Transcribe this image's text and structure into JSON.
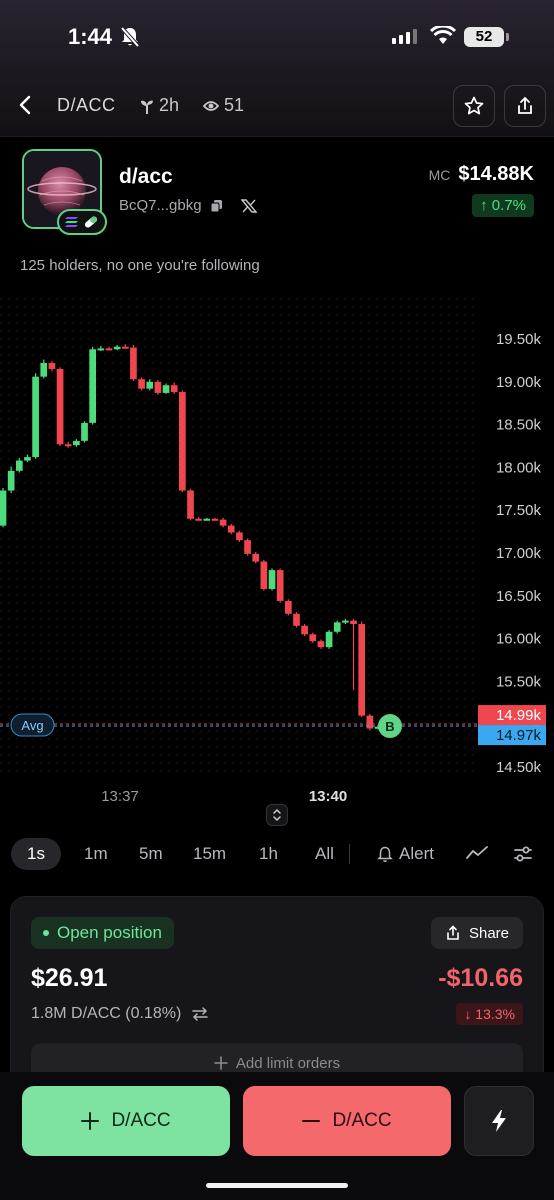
{
  "status_bar": {
    "time": "1:44",
    "battery": "52"
  },
  "nav": {
    "title": "D/ACC",
    "age": "2h",
    "watchers": "51"
  },
  "token": {
    "name": "d/acc",
    "address": "BcQ7...gbkg",
    "mc_label": "MC",
    "market_cap": "$14.88K",
    "mc_change": "↑ 0.7%",
    "holders_text": "125 holders, no one you're following"
  },
  "chart_data": {
    "type": "candlestick",
    "interval": "1s",
    "y_ticks": [
      "19.50k",
      "19.00k",
      "18.50k",
      "18.00k",
      "17.50k",
      "17.00k",
      "16.50k",
      "16.00k",
      "15.50k",
      "15.00k",
      "14.50k"
    ],
    "y_tick_values": [
      19500,
      19000,
      18500,
      18000,
      17500,
      17000,
      16500,
      16000,
      15500,
      15000,
      14500
    ],
    "x_ticks": [
      "13:37",
      "13:40"
    ],
    "avg_label": "Avg",
    "buy_marker": "B",
    "price_label_1": "14.99k",
    "price_label_2": "14.97k",
    "candles": [
      {
        "o": 17320,
        "c": 17730,
        "h": 17760,
        "l": 17300
      },
      {
        "o": 17730,
        "c": 17960,
        "h": 18010,
        "l": 17700
      },
      {
        "o": 17960,
        "c": 18080,
        "h": 18110,
        "l": 17940
      },
      {
        "o": 18080,
        "c": 18120,
        "h": 18150,
        "l": 18060
      },
      {
        "o": 18120,
        "c": 19060,
        "h": 19100,
        "l": 18100
      },
      {
        "o": 19060,
        "c": 19220,
        "h": 19260,
        "l": 19040
      },
      {
        "o": 19220,
        "c": 19150,
        "h": 19240,
        "l": 19120
      },
      {
        "o": 19150,
        "c": 18270,
        "h": 19170,
        "l": 18250
      },
      {
        "o": 18270,
        "c": 18260,
        "h": 18300,
        "l": 18230
      },
      {
        "o": 18260,
        "c": 18310,
        "h": 18330,
        "l": 18240
      },
      {
        "o": 18310,
        "c": 18520,
        "h": 18540,
        "l": 18290
      },
      {
        "o": 18520,
        "c": 19380,
        "h": 19410,
        "l": 18500
      },
      {
        "o": 19380,
        "c": 19390,
        "h": 19420,
        "l": 19360
      },
      {
        "o": 19390,
        "c": 19380,
        "h": 19410,
        "l": 19370
      },
      {
        "o": 19380,
        "c": 19410,
        "h": 19430,
        "l": 19370
      },
      {
        "o": 19410,
        "c": 19400,
        "h": 19440,
        "l": 19390
      },
      {
        "o": 19400,
        "c": 19030,
        "h": 19430,
        "l": 19010
      },
      {
        "o": 19030,
        "c": 18920,
        "h": 19050,
        "l": 18900
      },
      {
        "o": 18920,
        "c": 19000,
        "h": 19030,
        "l": 18900
      },
      {
        "o": 19000,
        "c": 18870,
        "h": 19020,
        "l": 18850
      },
      {
        "o": 18870,
        "c": 18960,
        "h": 18980,
        "l": 18860
      },
      {
        "o": 18960,
        "c": 18880,
        "h": 18990,
        "l": 18860
      },
      {
        "o": 18880,
        "c": 17730,
        "h": 18900,
        "l": 17710
      },
      {
        "o": 17730,
        "c": 17400,
        "h": 17750,
        "l": 17380
      },
      {
        "o": 17400,
        "c": 17390,
        "h": 17420,
        "l": 17380
      },
      {
        "o": 17390,
        "c": 17400,
        "h": 17410,
        "l": 17380
      },
      {
        "o": 17400,
        "c": 17390,
        "h": 17410,
        "l": 17380
      },
      {
        "o": 17390,
        "c": 17320,
        "h": 17410,
        "l": 17300
      },
      {
        "o": 17320,
        "c": 17240,
        "h": 17340,
        "l": 17220
      },
      {
        "o": 17240,
        "c": 17150,
        "h": 17260,
        "l": 17130
      },
      {
        "o": 17150,
        "c": 16990,
        "h": 17170,
        "l": 16970
      },
      {
        "o": 16990,
        "c": 16900,
        "h": 17010,
        "l": 16880
      },
      {
        "o": 16900,
        "c": 16580,
        "h": 16920,
        "l": 16560
      },
      {
        "o": 16580,
        "c": 16800,
        "h": 16820,
        "l": 16560
      },
      {
        "o": 16800,
        "c": 16440,
        "h": 16820,
        "l": 16420
      },
      {
        "o": 16440,
        "c": 16290,
        "h": 16460,
        "l": 16270
      },
      {
        "o": 16290,
        "c": 16150,
        "h": 16310,
        "l": 16130
      },
      {
        "o": 16150,
        "c": 16050,
        "h": 16170,
        "l": 16030
      },
      {
        "o": 16050,
        "c": 15970,
        "h": 16070,
        "l": 15950
      },
      {
        "o": 15970,
        "c": 15900,
        "h": 15990,
        "l": 15880
      },
      {
        "o": 15900,
        "c": 16080,
        "h": 16100,
        "l": 15880
      },
      {
        "o": 16080,
        "c": 16190,
        "h": 16210,
        "l": 16060
      },
      {
        "o": 16190,
        "c": 16210,
        "h": 16230,
        "l": 16170
      },
      {
        "o": 16210,
        "c": 16170,
        "h": 16230,
        "l": 15400
      },
      {
        "o": 16170,
        "c": 15100,
        "h": 16200,
        "l": 15080
      },
      {
        "o": 15100,
        "c": 14950,
        "h": 15120,
        "l": 14930
      },
      {
        "o": 14950,
        "c": 14970,
        "h": 14990,
        "l": 14940
      }
    ]
  },
  "timeframes": [
    "1s",
    "1m",
    "5m",
    "15m",
    "1h",
    "All"
  ],
  "alert_label": "Alert",
  "position": {
    "status": "Open position",
    "share_label": "Share",
    "value": "$26.91",
    "pnl": "-$10.66",
    "amount": "1.8M D/ACC (0.18%)",
    "pnl_pct": "↓ 13.3%",
    "limit_label": "Add limit orders"
  },
  "actions": {
    "buy_label": "D/ACC",
    "sell_label": "D/ACC"
  },
  "colors": {
    "up": "#4ddb7c",
    "down": "#f0464e",
    "accent_green": "#7ee2a0",
    "accent_red": "#f46a6c"
  }
}
